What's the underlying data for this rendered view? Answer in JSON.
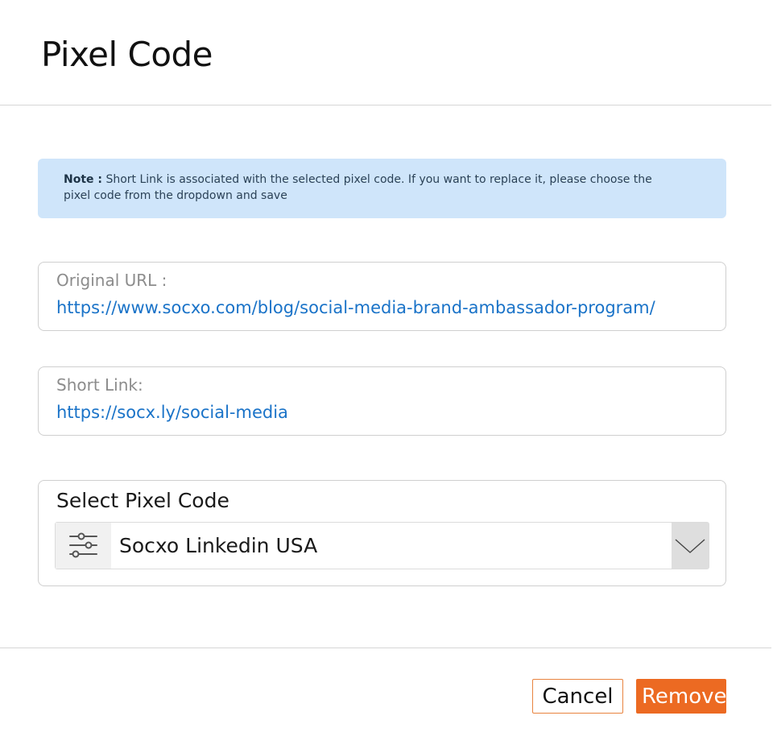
{
  "modal": {
    "title": "Pixel Code"
  },
  "note": {
    "label": "Note :",
    "text": " Short Link is associated with the selected pixel code. If you want to replace it, please choose the pixel code from the dropdown and save"
  },
  "original_url": {
    "label": "Original URL :",
    "value": "https://www.socxo.com/blog/social-media-brand-ambassador-program/"
  },
  "short_link": {
    "label": "Short Link:",
    "value": "https://socx.ly/social-media"
  },
  "pixel_select": {
    "label": "Select Pixel Code",
    "selected": "Socxo Linkedin USA",
    "icon": "sliders-icon",
    "arrow_icon": "chevron-down-icon"
  },
  "footer": {
    "cancel_label": "Cancel",
    "remove_label": "Remove"
  },
  "colors": {
    "note_bg": "#cfe5fa",
    "link": "#1a73c8",
    "accent": "#ec6a22"
  }
}
